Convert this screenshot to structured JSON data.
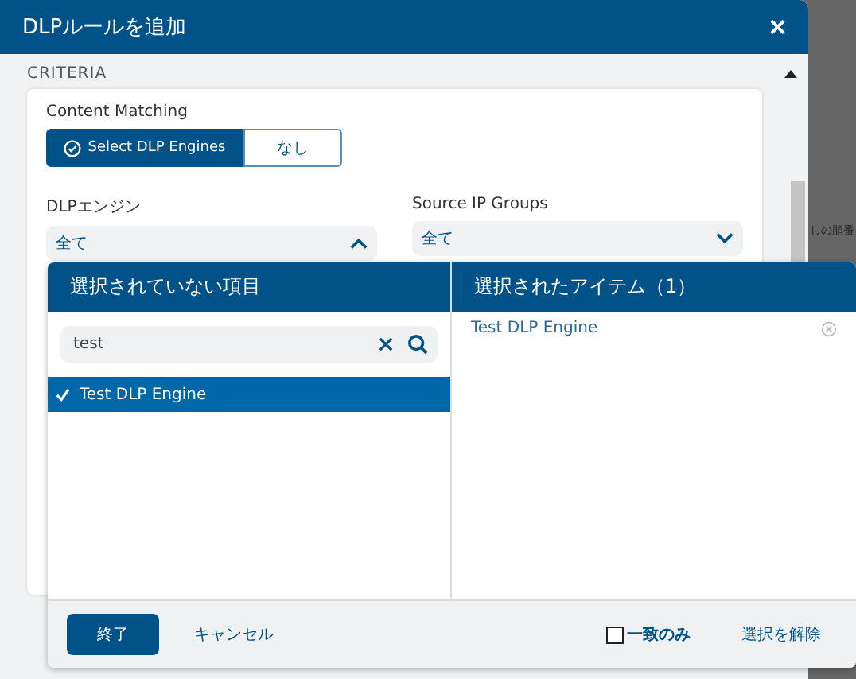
{
  "dialog": {
    "title": "DLPルールを追加",
    "close": "×",
    "section": "CRITERIA"
  },
  "background_text": "しの順番",
  "content_matching": {
    "label": "Content Matching",
    "options": [
      {
        "label": "Select DLP Engines",
        "selected": true
      },
      {
        "label": "なし",
        "selected": false
      }
    ]
  },
  "fields": [
    {
      "label": "DLPエンジン",
      "value": "全て",
      "expanded": true
    },
    {
      "label": "Source IP Groups",
      "value": "全て",
      "expanded": false
    }
  ],
  "picker": {
    "unselected_title": "選択されていない項目",
    "selected_title": "選択されたアイテム（1）",
    "search": {
      "value": "test"
    },
    "unselected_items": [
      {
        "label": "Test DLP Engine",
        "selected": true
      }
    ],
    "selected_items": [
      {
        "label": "Test DLP Engine"
      }
    ],
    "done": "終了",
    "cancel": "キャンセル",
    "exact_match": {
      "label": "一致のみ",
      "checked": false
    },
    "clear": "選択を解除"
  }
}
